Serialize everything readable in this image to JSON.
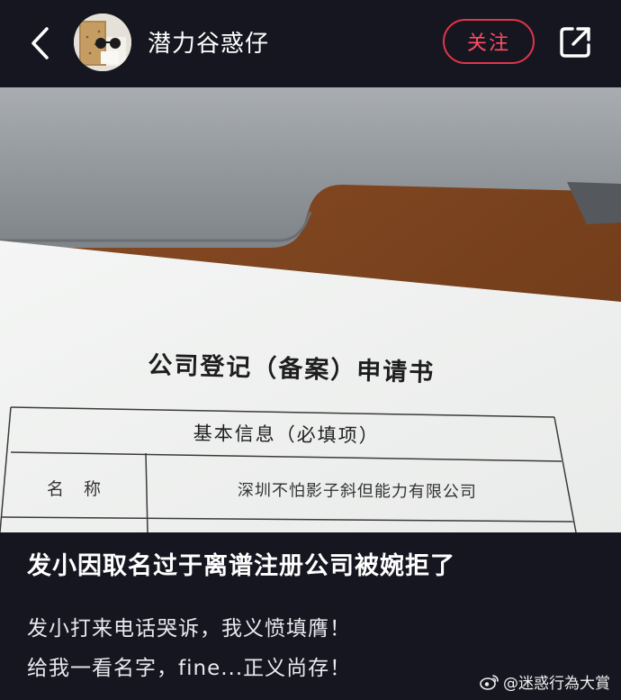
{
  "header": {
    "username": "潜力谷惑仔",
    "follow_label": "关注"
  },
  "photo": {
    "doc_title": "公司登记（备案）申请书",
    "section_title": "基本信息（必填项）",
    "field_label": "名称",
    "field_value": "深圳不怕影子斜但能力有限公司"
  },
  "caption": {
    "title": "发小因取名过于离谱注册公司被婉拒了",
    "line1": "发小打来电话哭诉，我义愤填膺！",
    "line2": "给我一看名字，fine...正义尚存！"
  },
  "watermark": {
    "text": "@迷惑行為大賞"
  },
  "colors": {
    "background": "#161620",
    "accent": "#e3344a"
  }
}
